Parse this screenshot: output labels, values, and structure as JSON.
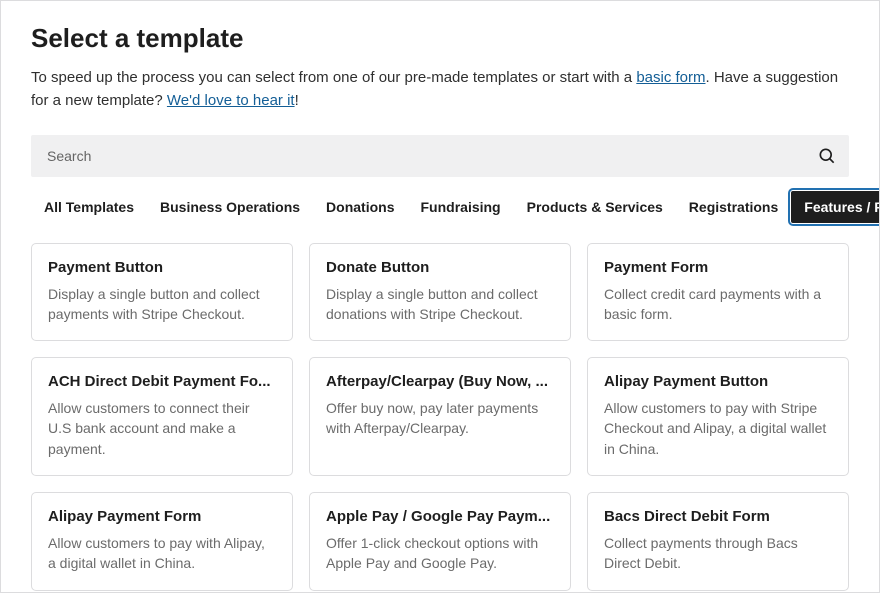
{
  "header": {
    "title": "Select a template",
    "intro_1": "To speed up the process you can select from one of our pre-made templates or start with a ",
    "basic_form_link": "basic form",
    "intro_2": ". Have a suggestion for a new template? ",
    "feedback_link": "We'd love to hear it",
    "intro_3": "!"
  },
  "search": {
    "placeholder": "Search"
  },
  "tabs": [
    {
      "label": "All Templates",
      "active": false
    },
    {
      "label": "Business Operations",
      "active": false
    },
    {
      "label": "Donations",
      "active": false
    },
    {
      "label": "Fundraising",
      "active": false
    },
    {
      "label": "Products & Services",
      "active": false
    },
    {
      "label": "Registrations",
      "active": false
    },
    {
      "label": "Features / Functionality",
      "active": true
    }
  ],
  "templates": [
    {
      "title": "Payment Button",
      "desc": "Display a single button and collect payments with Stripe Checkout."
    },
    {
      "title": "Donate Button",
      "desc": "Display a single button and collect donations with Stripe Checkout."
    },
    {
      "title": "Payment Form",
      "desc": "Collect credit card payments with a basic form."
    },
    {
      "title": "ACH Direct Debit Payment Fo...",
      "desc": "Allow customers to connect their U.S bank account and make a payment."
    },
    {
      "title": "Afterpay/Clearpay (Buy Now, ...",
      "desc": "Offer buy now, pay later payments with Afterpay/Clearpay."
    },
    {
      "title": "Alipay Payment Button",
      "desc": "Allow customers to pay with Stripe Checkout and Alipay, a digital wallet in China."
    },
    {
      "title": "Alipay Payment Form",
      "desc": "Allow customers to pay with Alipay, a digital wallet in China."
    },
    {
      "title": "Apple Pay / Google Pay Paym...",
      "desc": "Offer 1-click checkout options with Apple Pay and Google Pay."
    },
    {
      "title": "Bacs Direct Debit Form",
      "desc": "Collect payments through Bacs Direct Debit."
    }
  ]
}
